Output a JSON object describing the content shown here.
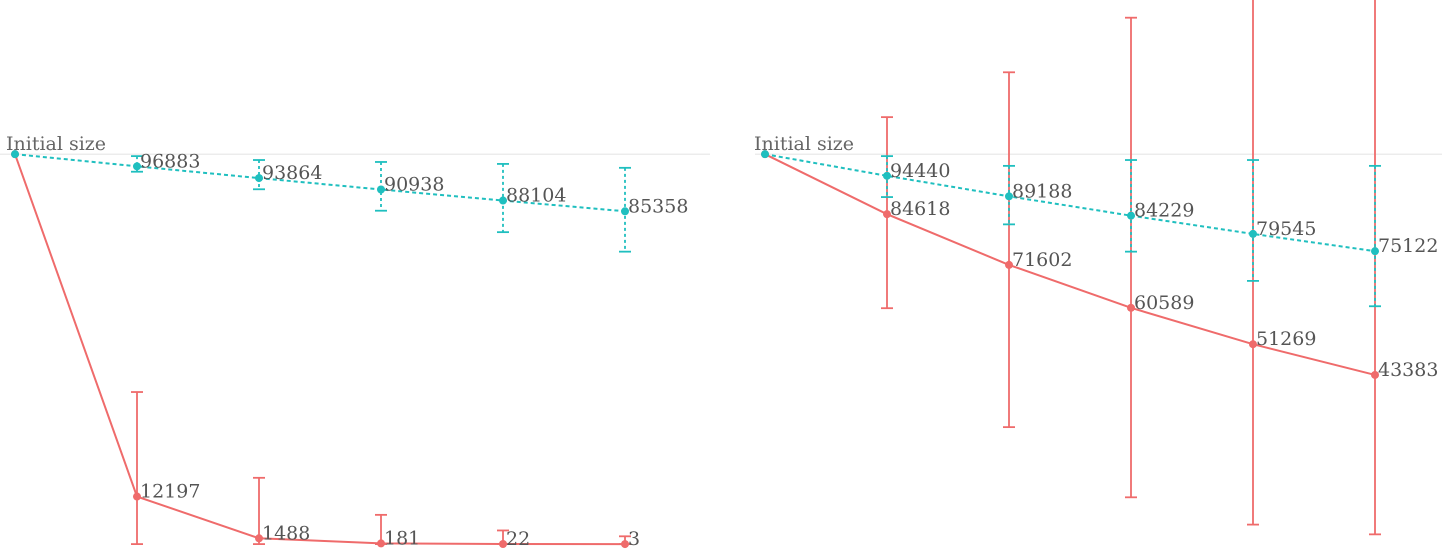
{
  "colors": {
    "red": "#ef6b6b",
    "teal": "#1fbfbf",
    "baseline": "#e6e6e6",
    "text": "#555555"
  },
  "chart_data": [
    {
      "type": "line",
      "panel": "left",
      "baseline_label": "Initial size",
      "baseline_value": 100000,
      "ylim": [
        -1000,
        138000
      ],
      "steps": 5,
      "series": [
        {
          "style": "dashed",
          "color": "teal",
          "values": [
            96883,
            93864,
            90938,
            88104,
            85358
          ],
          "labels": [
            "96883",
            "93864",
            "90938",
            "88104",
            "85358"
          ],
          "err_low": [
            95500,
            91000,
            85500,
            80000,
            75000
          ],
          "err_high": [
            99500,
            98500,
            98000,
            97500,
            96500
          ]
        },
        {
          "style": "solid",
          "color": "red",
          "values": [
            12197,
            1488,
            181,
            22,
            3
          ],
          "labels": [
            "12197",
            "1488",
            "181",
            "22",
            "3"
          ],
          "err_low": [
            0,
            0,
            0,
            0,
            0
          ],
          "err_high": [
            39000,
            17000,
            7500,
            3500,
            2000
          ]
        }
      ]
    },
    {
      "type": "line",
      "panel": "right",
      "baseline_label": "Initial size",
      "baseline_value": 100000,
      "ylim": [
        -1000,
        138000
      ],
      "steps": 5,
      "series": [
        {
          "style": "dashed",
          "color": "teal",
          "values": [
            94440,
            89188,
            84229,
            79545,
            75122
          ],
          "labels": [
            "94440",
            "89188",
            "84229",
            "79545",
            "75122"
          ],
          "err_low": [
            89000,
            82000,
            75000,
            67500,
            61000
          ],
          "err_high": [
            99500,
            97000,
            98500,
            98500,
            97000
          ]
        },
        {
          "style": "solid",
          "color": "red",
          "values": [
            84618,
            71602,
            60589,
            51269,
            43383
          ],
          "labels": [
            "84618",
            "71602",
            "60589",
            "51269",
            "43383"
          ],
          "err_low": [
            60500,
            30000,
            12000,
            5000,
            2500
          ],
          "err_high": [
            109500,
            121000,
            135000,
            150000,
            168000
          ]
        }
      ]
    }
  ]
}
